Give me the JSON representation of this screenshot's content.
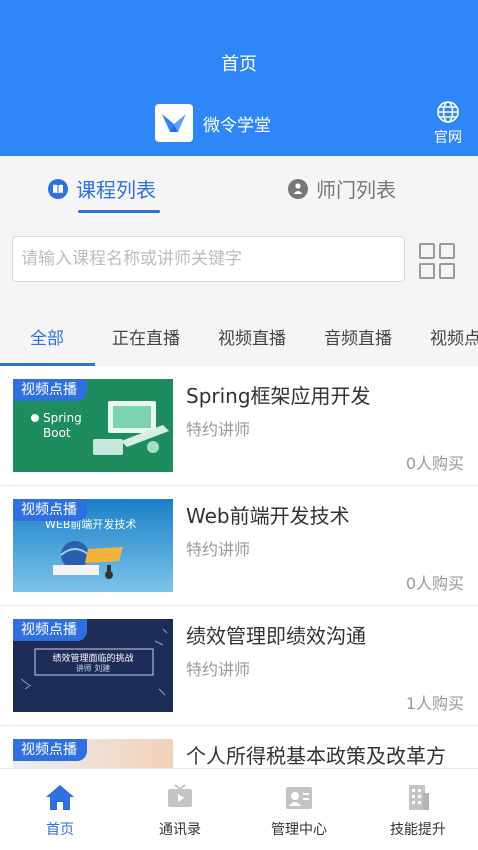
{
  "header": {
    "title": "首页",
    "brand_name": "微令学堂",
    "website_label": "官网"
  },
  "main_tabs": [
    {
      "label": "课程列表",
      "active": true
    },
    {
      "label": "师门列表",
      "active": false
    }
  ],
  "search": {
    "placeholder": "请输入课程名称或讲师关键字",
    "value": ""
  },
  "categories": [
    {
      "label": "全部",
      "active": true
    },
    {
      "label": "正在直播",
      "active": false
    },
    {
      "label": "视频直播",
      "active": false
    },
    {
      "label": "音频直播",
      "active": false
    },
    {
      "label": "视频点播",
      "active": false
    }
  ],
  "courses": [
    {
      "badge": "视频点播",
      "title": "Spring框架应用开发",
      "teacher": "特约讲师",
      "buyers": "0人购买",
      "thumb_text": "Spring Boot"
    },
    {
      "badge": "视频点播",
      "title": "Web前端开发技术",
      "teacher": "特约讲师",
      "buyers": "0人购买",
      "thumb_text": "WEB前端开发技术"
    },
    {
      "badge": "视频点播",
      "title": "绩效管理即绩效沟通",
      "teacher": "特约讲师",
      "buyers": "1人购买",
      "thumb_text": "绩效管理面临的挑战",
      "thumb_subtext": "讲师 刘建"
    },
    {
      "badge": "视频点播",
      "title": "个人所得税基本政策及改革方",
      "teacher": "",
      "buyers": ""
    }
  ],
  "bottom_nav": [
    {
      "label": "首页",
      "icon": "home-icon",
      "active": true
    },
    {
      "label": "通讯录",
      "icon": "tv-icon",
      "active": false
    },
    {
      "label": "管理中心",
      "icon": "contact-card-icon",
      "active": false
    },
    {
      "label": "技能提升",
      "icon": "building-icon",
      "active": false
    }
  ],
  "colors": {
    "header_bg": "#2f86f6",
    "accent": "#2f6fe0",
    "badge_bg": "#2f6fe0"
  }
}
